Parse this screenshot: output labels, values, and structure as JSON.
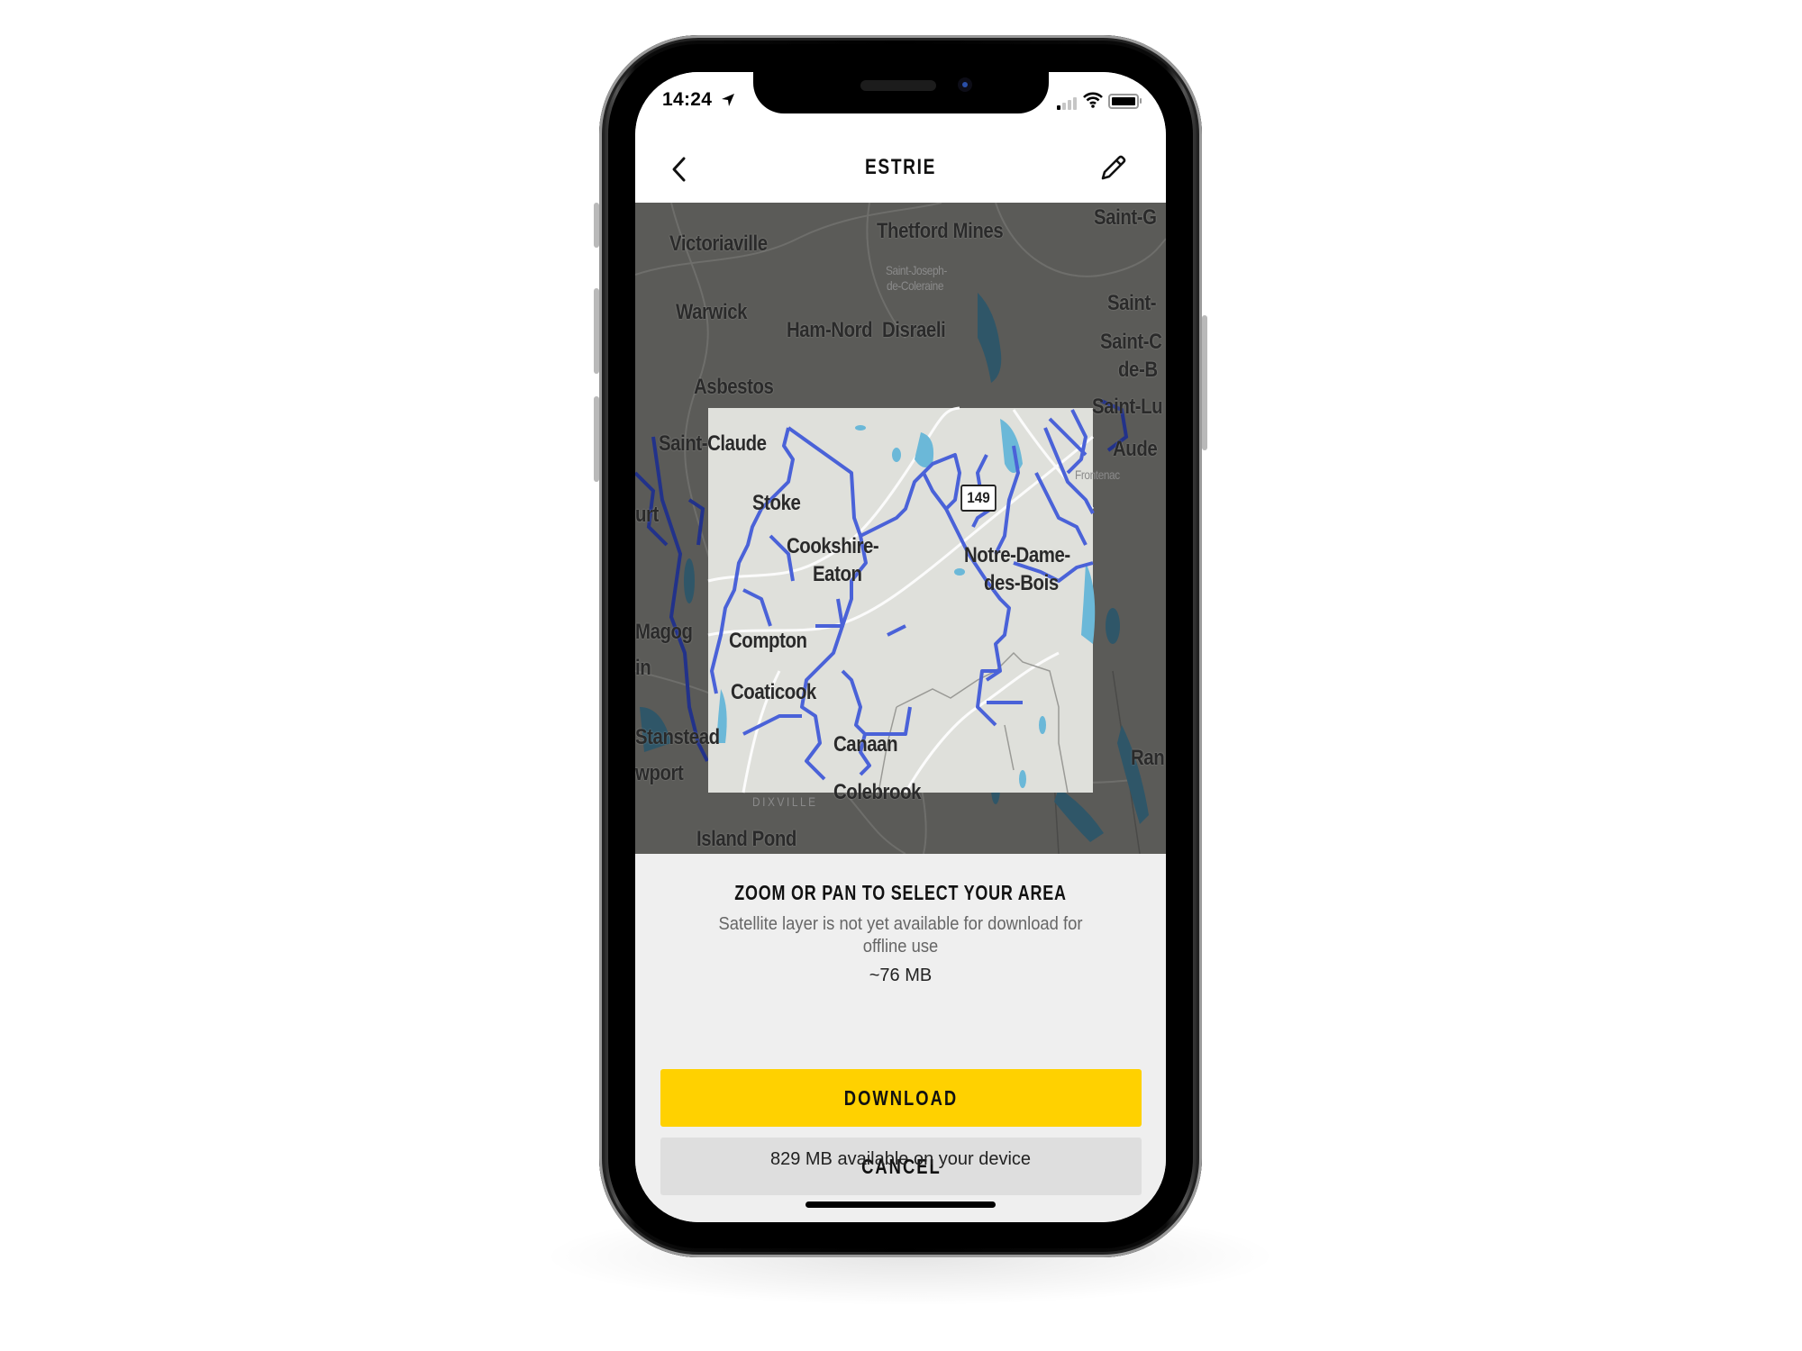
{
  "status_bar": {
    "time": "14:24",
    "location_icon": "location-arrow-icon",
    "signal_bars_total": 4,
    "signal_bars_active": 1,
    "wifi_icon": "wifi-icon",
    "battery_icon": "battery-full-icon"
  },
  "nav": {
    "back_icon": "chevron-left-icon",
    "title": "ESTRIE",
    "edit_icon": "pencil-icon"
  },
  "map": {
    "road_shield": "149",
    "labels_outside": [
      "Victoriaville",
      "Thetford Mines",
      "Saint-G",
      "Warwick",
      "Ham-Nord",
      "Disraeli",
      "Saint-",
      "Saint-C",
      "de-B",
      "Saint-Lu",
      "Aude",
      "urt",
      "Magog",
      "in",
      "Stanstead",
      "wport",
      "Canaan",
      "Colebrook",
      "Island Pond",
      "Ran"
    ],
    "labels_inside": [
      "Asbestos",
      "Saint-Claude",
      "Stoke",
      "Cookshire-",
      "Eaton",
      "Notre-Dame-",
      "des-Bois",
      "Compton",
      "Coaticook"
    ],
    "minor_labels": [
      "Saint-Joseph-",
      "de-Coleraine",
      "Frontenac",
      "DIXVILLE"
    ],
    "colors": {
      "dim_overlay": "#5b5b58",
      "selection_fill": "#dfe0db",
      "trail": "#4a62d8",
      "trail_dark": "#22328a",
      "water": "#6bb8d8",
      "water_dim": "#2f5668"
    }
  },
  "sheet": {
    "title": "ZOOM OR PAN TO SELECT YOUR AREA",
    "subtitle": "Satellite layer is not yet available for download for offline use",
    "size_estimate": "~76 MB",
    "download_label": "DOWNLOAD",
    "cancel_label": "CANCEL",
    "available_storage": "829 MB available on your device",
    "accent_color": "#ffd100"
  }
}
